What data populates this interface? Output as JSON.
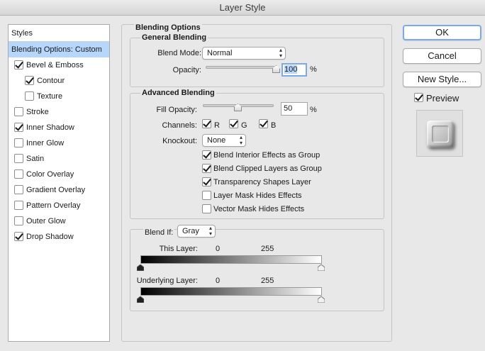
{
  "window": {
    "title": "Layer Style"
  },
  "styles": {
    "header": "Styles",
    "items": [
      {
        "label": "Blending Options: Custom",
        "has_checkbox": false,
        "checked": false,
        "selected": true,
        "indent": 0
      },
      {
        "label": "Bevel & Emboss",
        "has_checkbox": true,
        "checked": true,
        "selected": false,
        "indent": 0
      },
      {
        "label": "Contour",
        "has_checkbox": true,
        "checked": true,
        "selected": false,
        "indent": 1
      },
      {
        "label": "Texture",
        "has_checkbox": true,
        "checked": false,
        "selected": false,
        "indent": 1
      },
      {
        "label": "Stroke",
        "has_checkbox": true,
        "checked": false,
        "selected": false,
        "indent": 0
      },
      {
        "label": "Inner Shadow",
        "has_checkbox": true,
        "checked": true,
        "selected": false,
        "indent": 0
      },
      {
        "label": "Inner Glow",
        "has_checkbox": true,
        "checked": false,
        "selected": false,
        "indent": 0
      },
      {
        "label": "Satin",
        "has_checkbox": true,
        "checked": false,
        "selected": false,
        "indent": 0
      },
      {
        "label": "Color Overlay",
        "has_checkbox": true,
        "checked": false,
        "selected": false,
        "indent": 0
      },
      {
        "label": "Gradient Overlay",
        "has_checkbox": true,
        "checked": false,
        "selected": false,
        "indent": 0
      },
      {
        "label": "Pattern Overlay",
        "has_checkbox": true,
        "checked": false,
        "selected": false,
        "indent": 0
      },
      {
        "label": "Outer Glow",
        "has_checkbox": true,
        "checked": false,
        "selected": false,
        "indent": 0
      },
      {
        "label": "Drop Shadow",
        "has_checkbox": true,
        "checked": true,
        "selected": false,
        "indent": 0
      }
    ]
  },
  "blending": {
    "title": "Blending Options",
    "general": {
      "title": "General Blending",
      "blend_mode_label": "Blend Mode:",
      "blend_mode_value": "Normal",
      "opacity_label": "Opacity:",
      "opacity_value": "100",
      "opacity_unit": "%",
      "opacity_fraction": 1.0
    },
    "advanced": {
      "title": "Advanced Blending",
      "fill_opacity_label": "Fill Opacity:",
      "fill_opacity_value": "50",
      "fill_opacity_unit": "%",
      "fill_opacity_fraction": 0.5,
      "channels_label": "Channels:",
      "channels": [
        {
          "label": "R",
          "checked": true
        },
        {
          "label": "G",
          "checked": true
        },
        {
          "label": "B",
          "checked": true
        }
      ],
      "knockout_label": "Knockout:",
      "knockout_value": "None",
      "options": [
        {
          "label": "Blend Interior Effects as Group",
          "checked": true
        },
        {
          "label": "Blend Clipped Layers as Group",
          "checked": true
        },
        {
          "label": "Transparency Shapes Layer",
          "checked": true
        },
        {
          "label": "Layer Mask Hides Effects",
          "checked": false
        },
        {
          "label": "Vector Mask Hides Effects",
          "checked": false
        }
      ]
    },
    "blend_if": {
      "label": "Blend If:",
      "value": "Gray",
      "this_layer": {
        "label": "This Layer:",
        "low": "0",
        "high": "255"
      },
      "underlying_layer": {
        "label": "Underlying Layer:",
        "low": "0",
        "high": "255"
      }
    }
  },
  "buttons": {
    "ok": "OK",
    "cancel": "Cancel",
    "new_style": "New Style...",
    "preview_label": "Preview",
    "preview_checked": true
  }
}
